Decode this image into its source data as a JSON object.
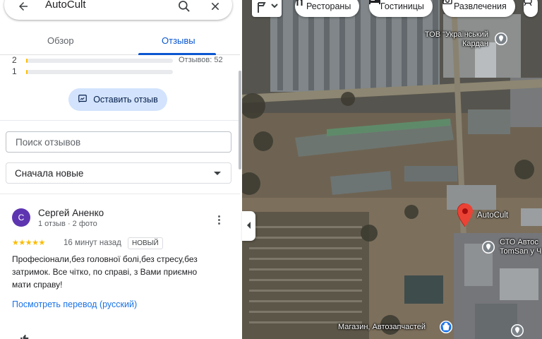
{
  "search": {
    "query": "AutoCult",
    "back_icon": "arrow-left-icon",
    "search_icon": "search-icon",
    "close_icon": "close-icon"
  },
  "tabs": [
    {
      "label": "Обзор",
      "active": false
    },
    {
      "label": "Отзывы",
      "active": true
    }
  ],
  "rating_summary": {
    "rows": [
      {
        "stars": "2",
        "share": 0.01
      },
      {
        "stars": "1",
        "share": 0.01
      }
    ],
    "review_count": "Отзывов: 52"
  },
  "write_review_label": "Оставить отзыв",
  "review_search_placeholder": "Поиск отзывов",
  "sort": {
    "selected": "Сначала новые"
  },
  "review": {
    "avatar_letter": "С",
    "avatar_color": "#5e35b1",
    "author": "Сергей Аненко",
    "author_meta": "1 отзыв · 2 фото",
    "stars": "★★★★★",
    "rating": 5,
    "time": "16 минут назад",
    "badge": "НОВЫЙ",
    "text": "Професіонали,без головної болі,без стресу,без затримок. Все чітко, по справі,  з Вами приємно мати справу!",
    "translate_link": "Посмотреть перевод (русский)"
  },
  "map": {
    "chips": [
      {
        "label": "Рестораны",
        "icon": "fork-knife-icon"
      },
      {
        "label": "Гостиницы",
        "icon": "bed-icon"
      },
      {
        "label": "Развлечения",
        "icon": "camera-icon"
      }
    ],
    "pois": [
      {
        "label": "ТОВ \"Український Кардан",
        "line1": "ТОВ \"Український",
        "line2": "Кардан"
      },
      {
        "label": "AutoCult"
      },
      {
        "label": "СТО Автос TomSan у",
        "line1": "СТО Автос",
        "line2": "TomSan у Ч"
      },
      {
        "label": "Магазин, Автозапчастей"
      }
    ],
    "accent": "#ea4335"
  }
}
